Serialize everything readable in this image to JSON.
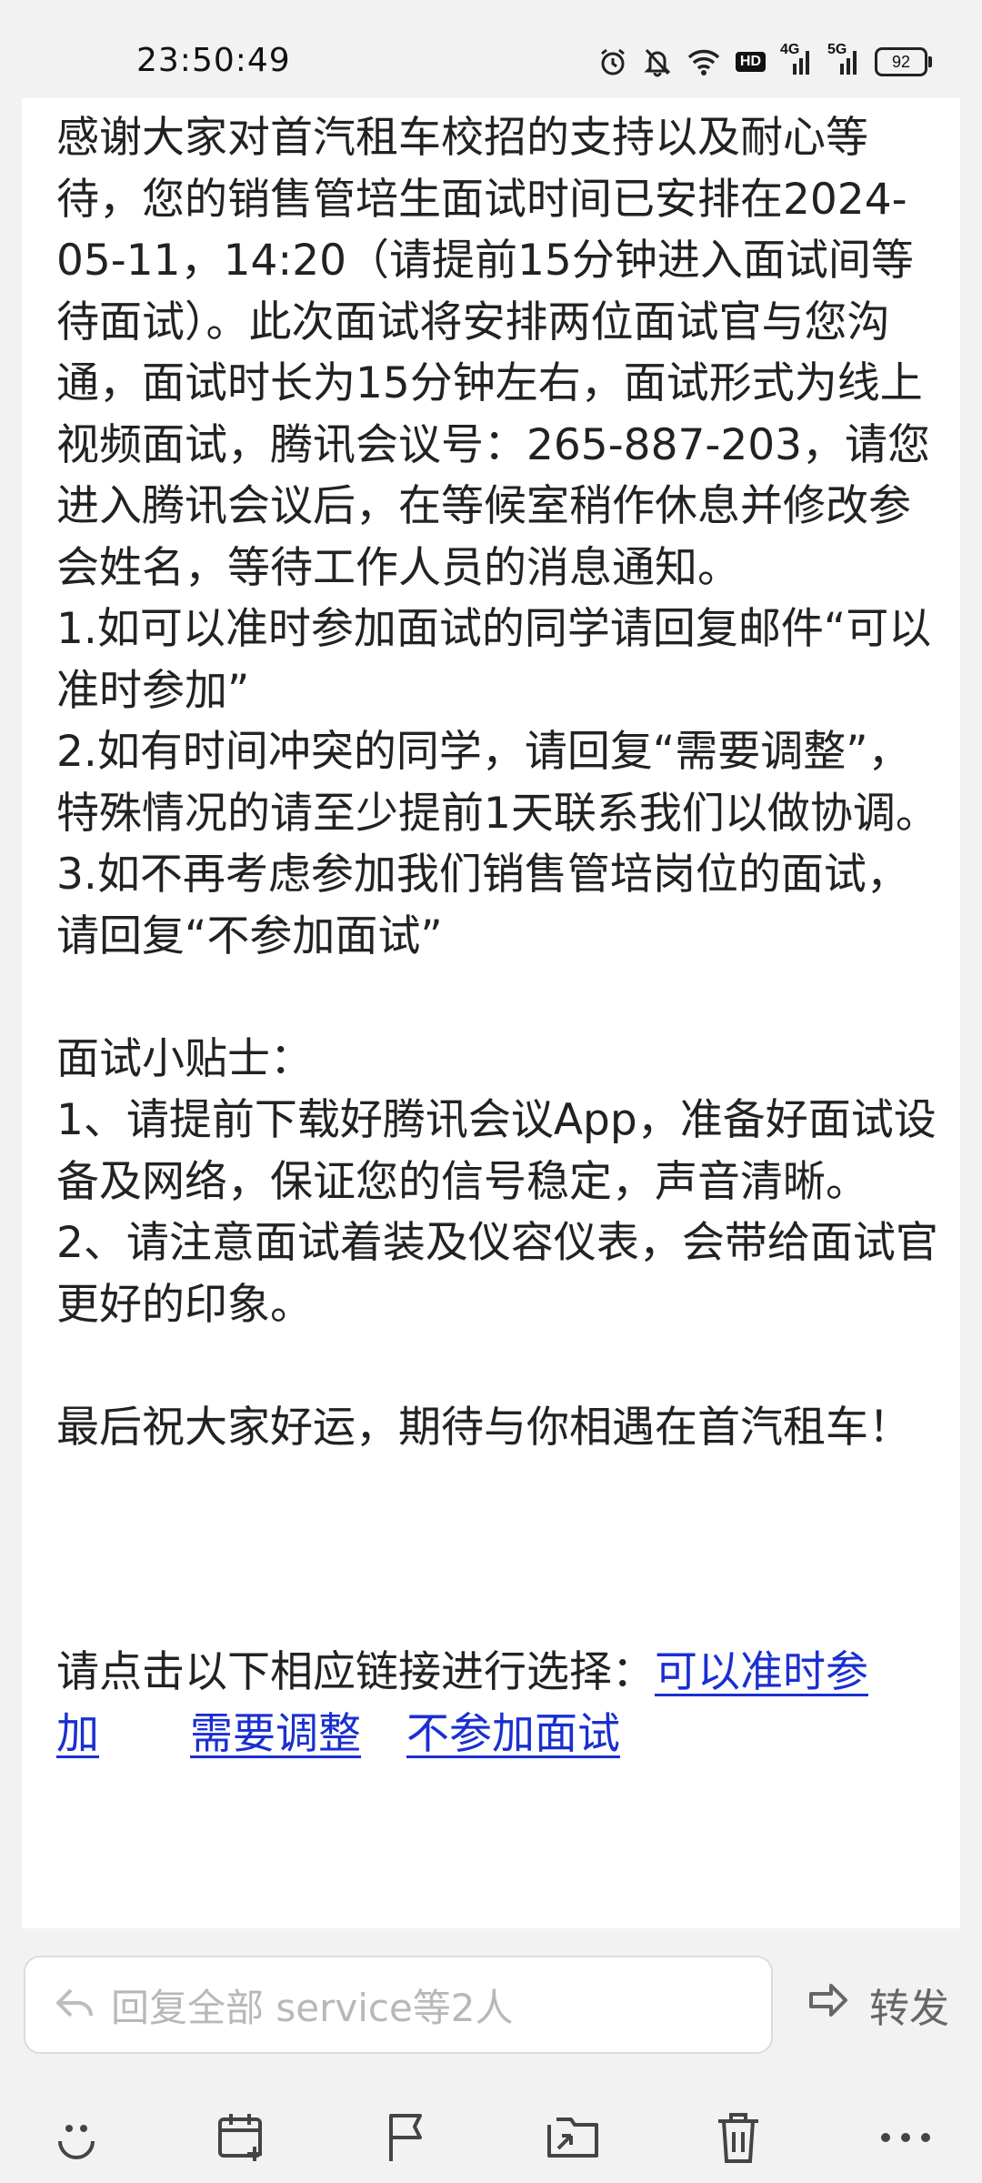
{
  "status_bar": {
    "time": "23:50:49",
    "network_4g": "4G",
    "network_5g": "5G",
    "hd": "HD",
    "battery": "92"
  },
  "email": {
    "paragraph_main": "感谢大家对首汽租车校招的支持以及耐心等待，您的销售管培生面试时间已安排在2024-05-11，14:20（请提前15分钟进入面试间等待面试）。此次面试将安排两位面试官与您沟通，面试时长为15分钟左右，面试形式为线上视频面试，腾讯会议号：265-887-203，请您进入腾讯会议后，在等候室稍作休息并修改参会姓名，等待工作人员的消息通知。",
    "option_1": "1.如可以准时参加面试的同学请回复邮件“可以准时参加”",
    "option_2": "2.如有时间冲突的同学，请回复“需要调整”，特殊情况的请至少提前1天联系我们以做协调。",
    "option_3": "3.如不再考虑参加我们销售管培岗位的面试，请回复“不参加面试”",
    "tips_title": "面试小贴士：",
    "tip_1": "1、请提前下载好腾讯会议App，准备好面试设备及网络，保证您的信号稳定，声音清晰。",
    "tip_2": "2、请注意面试着装及仪容仪表，会带给面试官更好的印象。",
    "closing": "最后祝大家好运，期待与你相遇在首汽租车！",
    "link_prompt": "请点击以下相应链接进行选择：",
    "link_attend": "可以准时参加",
    "link_adjust": "需要调整",
    "link_decline": "不参加面试"
  },
  "reply_bar": {
    "reply_placeholder": "回复全部 service等2人",
    "forward_label": "转发"
  },
  "toolbar": {
    "icons": [
      "smile-icon",
      "calendar-add-icon",
      "flag-icon",
      "move-folder-icon",
      "trash-icon",
      "more-icon"
    ]
  },
  "colors": {
    "link": "#1a2fd0",
    "background": "#f2f2f2",
    "card": "#ffffff",
    "placeholder": "#b8b8b8"
  }
}
